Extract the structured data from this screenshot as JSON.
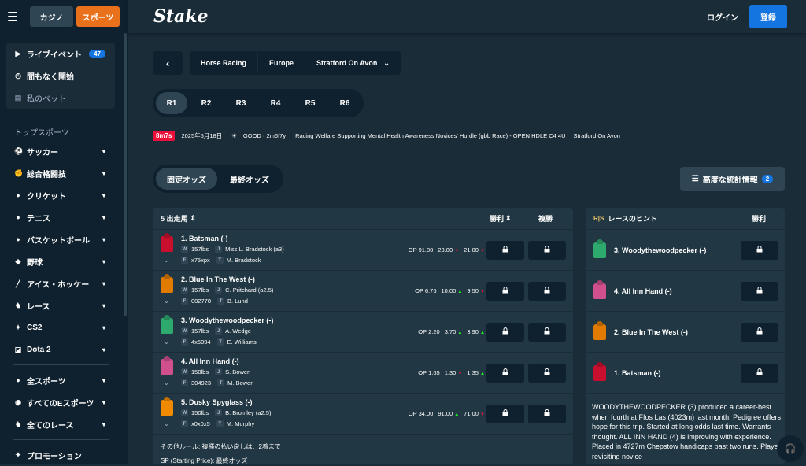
{
  "sidebar": {
    "casino": "カジノ",
    "sports": "スポーツ",
    "live": "ライブイベント",
    "live_count": "47",
    "upcoming": "間もなく開始",
    "mybets": "私のベット",
    "top_header": "トップスポーツ",
    "items": [
      "サッカー",
      "総合格闘技",
      "クリケット",
      "テニス",
      "バスケットボール",
      "野球",
      "アイス・ホッケー",
      "レース",
      "CS2",
      "Dota 2"
    ],
    "all_sports": "全スポーツ",
    "all_esports": "すべてのEスポーツ",
    "all_races": "全てのレース",
    "promotions": "プロモーション"
  },
  "header": {
    "logo": "Stake",
    "login": "ログイン",
    "register": "登録"
  },
  "breadcrumb": {
    "sport": "Horse Racing",
    "region": "Europe",
    "venue": "Stratford On Avon"
  },
  "races": [
    "R1",
    "R2",
    "R3",
    "R4",
    "R5",
    "R6"
  ],
  "race_info": {
    "timer": "8m7s",
    "date": "2025年5月18日",
    "going": "GOOD · 2m6f7y",
    "title": "Racing Welfare Supporting Mental Health Awareness Novices' Hurdle (gbb Race) - OPEN HDLE C4 4U",
    "venue": "Stratford On Avon"
  },
  "odds_tabs": {
    "fixed": "固定オッズ",
    "final": "最終オッズ"
  },
  "stats_button": {
    "label": "高度な統計情報",
    "count": "2"
  },
  "runners_panel": {
    "header": "5 出走馬",
    "win": "勝利",
    "place": "複勝",
    "runners": [
      {
        "name": "1. Batsman (-)",
        "weight": "157lbs",
        "jockey": "Miss L. Bradstock (a3)",
        "form": "x75xpx",
        "trainer": "M. Bradstock",
        "op": "OP 91.00",
        "o1": "23.00",
        "o2": "21.00",
        "d1": "down",
        "d2": "down",
        "silk": "#c8102e"
      },
      {
        "name": "2. Blue In The West (-)",
        "weight": "157lbs",
        "jockey": "C. Pritchard (a2.5)",
        "form": "002778",
        "trainer": "B. Lund",
        "op": "OP 6.75",
        "o1": "10.00",
        "o2": "9.50",
        "d1": "up",
        "d2": "down",
        "silk": "#e07b00"
      },
      {
        "name": "3. Woodythewoodpecker (-)",
        "weight": "157lbs",
        "jockey": "A. Wedge",
        "form": "4x5094",
        "trainer": "E. Williams",
        "op": "OP 2.20",
        "o1": "3.70",
        "o2": "3.90",
        "d1": "up",
        "d2": "up",
        "silk": "#2faa6e"
      },
      {
        "name": "4. All Inn Hand (-)",
        "weight": "150lbs",
        "jockey": "S. Bowen",
        "form": "304923",
        "trainer": "M. Bowen",
        "op": "OP 1.65",
        "o1": "1.30",
        "o2": "1.35",
        "d1": "down",
        "d2": "up",
        "silk": "#d0508e"
      },
      {
        "name": "5. Dusky Spyglass (-)",
        "weight": "150lbs",
        "jockey": "B. Bromley (a2.5)",
        "form": "x0x0x5",
        "trainer": "M. Murphy",
        "op": "OP 34.00",
        "o1": "91.00",
        "o2": "71.00",
        "d1": "up",
        "d2": "down",
        "silk": "#f08a00"
      }
    ],
    "rule": "その他ルール: 複勝の払い戻しは、2着まで",
    "sp": "SP (Starting Price): 最終オッズ"
  },
  "hints_panel": {
    "logo": "R|S",
    "header": "レースのヒント",
    "win": "勝利",
    "picks": [
      {
        "name": "3. Woodythewoodpecker (-)",
        "silk": "#2faa6e"
      },
      {
        "name": "4. All Inn Hand (-)",
        "silk": "#d0508e"
      },
      {
        "name": "2. Blue In The West (-)",
        "silk": "#e07b00"
      },
      {
        "name": "1. Batsman (-)",
        "silk": "#c8102e"
      }
    ],
    "text": "WOODYTHEWOODPECKER (3) produced a career-best when fourth at Ffos Las (4023m) last month. Pedigree offers hope for this trip. Started at long odds last time. Warrants thought. ALL INN HAND (4) is improving with experience. Placed in 4727m Chepstow handicaps past two runs. Player revisiting novice"
  },
  "labels": {
    "W": "W",
    "J": "J",
    "F": "F",
    "T": "T"
  }
}
